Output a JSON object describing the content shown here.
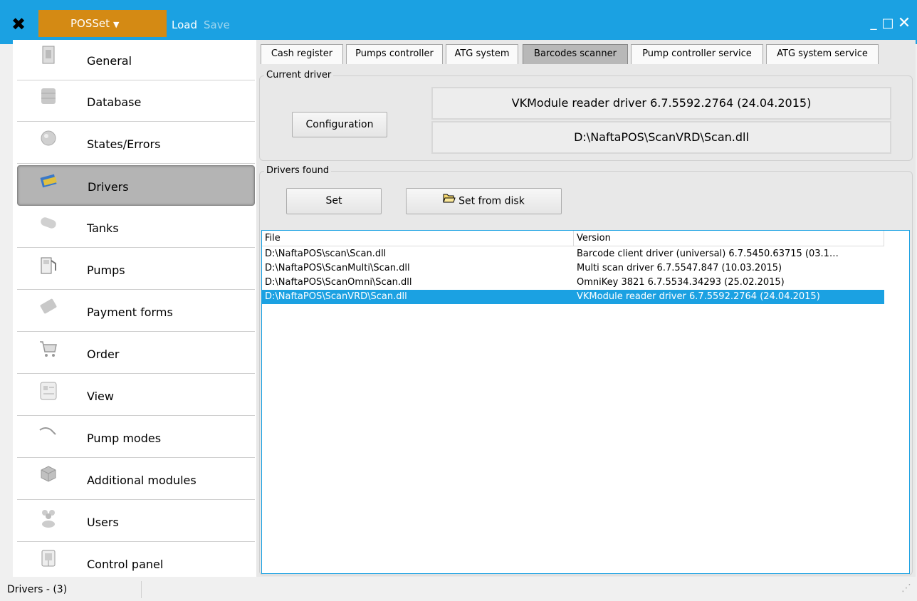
{
  "titlebar": {
    "menu_label": "POSSet",
    "load_label": "Load",
    "save_label": "Save",
    "minimize_glyph": "_",
    "maximize_glyph": "□",
    "close_glyph": "✕"
  },
  "sidebar": {
    "items": [
      {
        "label": "General",
        "icon": "general-icon"
      },
      {
        "label": "Database",
        "icon": "database-icon"
      },
      {
        "label": "States/Errors",
        "icon": "states-errors-icon"
      },
      {
        "label": "Drivers",
        "icon": "drivers-icon",
        "selected": true
      },
      {
        "label": "Tanks",
        "icon": "tanks-icon"
      },
      {
        "label": "Pumps",
        "icon": "pumps-icon"
      },
      {
        "label": "Payment forms",
        "icon": "payment-forms-icon"
      },
      {
        "label": "Order",
        "icon": "order-icon"
      },
      {
        "label": "View",
        "icon": "view-icon"
      },
      {
        "label": "Pump modes",
        "icon": "pump-modes-icon"
      },
      {
        "label": "Additional modules",
        "icon": "additional-modules-icon"
      },
      {
        "label": "Users",
        "icon": "users-icon"
      },
      {
        "label": "Control panel",
        "icon": "control-panel-icon"
      }
    ]
  },
  "tabs": [
    {
      "label": "Cash register"
    },
    {
      "label": "Pumps controller"
    },
    {
      "label": "ATG system"
    },
    {
      "label": "Barcodes scanner",
      "active": true
    },
    {
      "label": "Pump controller service"
    },
    {
      "label": "ATG system service"
    }
  ],
  "current_driver": {
    "title": "Current driver",
    "configuration_label": "Configuration",
    "name": "VKModule reader driver 6.7.5592.2764 (24.04.2015)",
    "path": "D:\\NaftaPOS\\ScanVRD\\Scan.dll"
  },
  "drivers_found": {
    "title": "Drivers found",
    "set_label": "Set",
    "set_from_disk_label": "Set from disk",
    "columns": [
      "File",
      "Version"
    ],
    "rows": [
      {
        "file": "D:\\NaftaPOS\\scan\\Scan.dll",
        "version": "Barcode client driver (universal) 6.7.5450.63715 (03.1…"
      },
      {
        "file": "D:\\NaftaPOS\\ScanMulti\\Scan.dll",
        "version": "Multi scan driver 6.7.5547.847 (10.03.2015)"
      },
      {
        "file": "D:\\NaftaPOS\\ScanOmni\\Scan.dll",
        "version": "OmniKey 3821 6.7.5534.34293 (25.02.2015)"
      },
      {
        "file": "D:\\NaftaPOS\\ScanVRD\\Scan.dll",
        "version": "VKModule reader driver 6.7.5592.2764 (24.04.2015)",
        "selected": true
      }
    ]
  },
  "statusbar": {
    "text": "Drivers - (3)"
  },
  "colors": {
    "accent": "#1ba1e2",
    "menu": "#d48a14",
    "selected_nav": "#b4b4b4"
  }
}
